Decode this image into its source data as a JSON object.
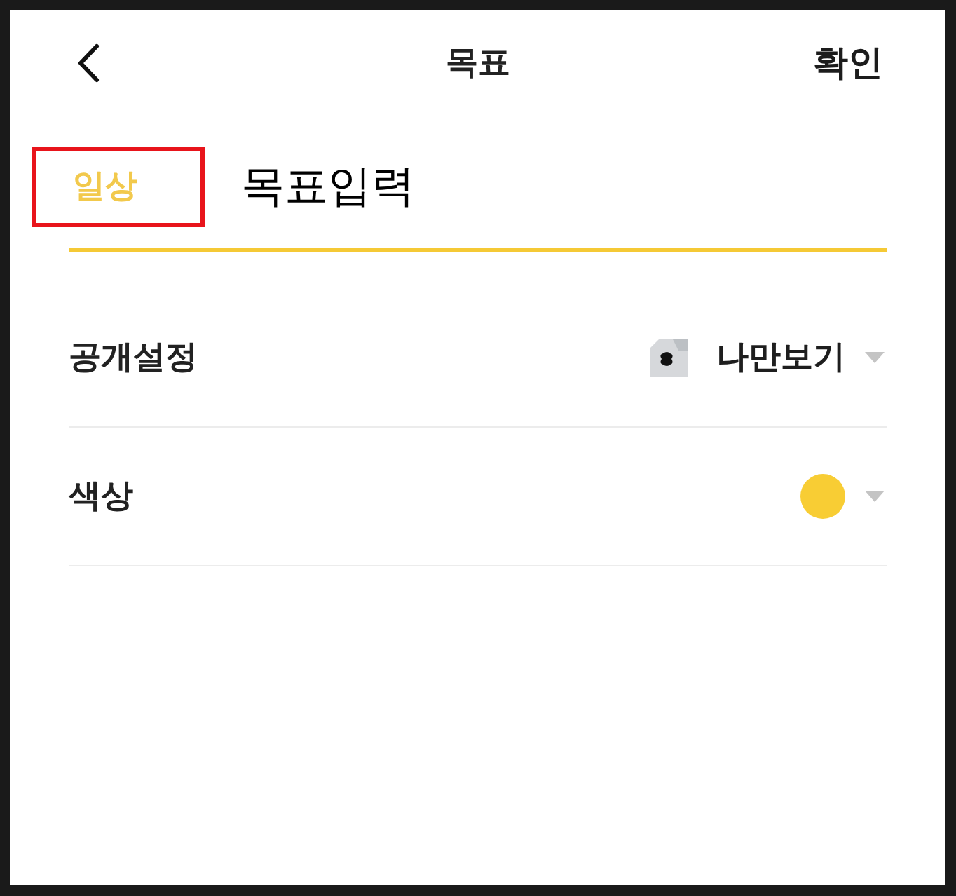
{
  "header": {
    "title": "목표",
    "confirm": "확인"
  },
  "goal": {
    "category": {
      "label": "일상",
      "highlighted": true
    },
    "input": {
      "placeholder": "목표입력"
    }
  },
  "settings": [
    {
      "kind": "select",
      "label": "공개설정",
      "value": "나만보기"
    },
    {
      "kind": "color",
      "label": "색상",
      "color": "#f8cd34"
    }
  ]
}
